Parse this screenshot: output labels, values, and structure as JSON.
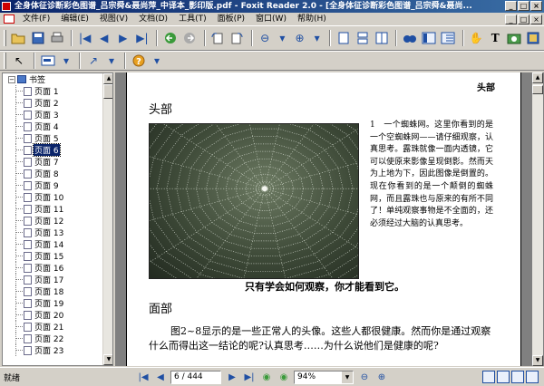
{
  "window": {
    "title": "全身体征诊断彩色图谱_吕宗舜&聂尚萍_中译本_影印版.pdf - Foxit Reader 2.0 - [全身体征诊断彩色图谱_吕宗舜&聂尚...",
    "minimize_glyph": "_",
    "maximize_glyph": "□",
    "close_glyph": "×"
  },
  "menu": {
    "items": [
      {
        "label": "文件(F)"
      },
      {
        "label": "编辑(E)"
      },
      {
        "label": "视图(V)"
      },
      {
        "label": "文档(D)"
      },
      {
        "label": "工具(T)"
      },
      {
        "label": "面板(P)"
      },
      {
        "label": "窗口(W)"
      },
      {
        "label": "帮助(H)"
      }
    ]
  },
  "toolbar": {
    "icons": [
      "open-icon",
      "save-icon",
      "print-icon",
      "first-page-icon",
      "prev-page-icon",
      "next-page-icon",
      "last-page-icon",
      "back-icon",
      "forward-icon",
      "rotate-left-icon",
      "rotate-right-icon",
      "zoom-out-icon",
      "zoom-in-icon",
      "single-page-icon",
      "continuous-icon",
      "facing-icon",
      "find-icon",
      "bookmarks-icon",
      "thumbnails-icon",
      "hand-tool-icon",
      "text-select-icon",
      "snapshot-icon",
      "properties-icon"
    ]
  },
  "sidebar": {
    "root_label": "书签",
    "items": [
      {
        "label": "页面 1"
      },
      {
        "label": "页面 2"
      },
      {
        "label": "页面 3"
      },
      {
        "label": "页面 4"
      },
      {
        "label": "页面 5"
      },
      {
        "label": "页面 6"
      },
      {
        "label": "页面 7"
      },
      {
        "label": "页面 8"
      },
      {
        "label": "页面 9"
      },
      {
        "label": "页面 10"
      },
      {
        "label": "页面 11"
      },
      {
        "label": "页面 12"
      },
      {
        "label": "页面 13"
      },
      {
        "label": "页面 14"
      },
      {
        "label": "页面 15"
      },
      {
        "label": "页面 16"
      },
      {
        "label": "页面 17"
      },
      {
        "label": "页面 18"
      },
      {
        "label": "页面 19"
      },
      {
        "label": "页面 20"
      },
      {
        "label": "页面 21"
      },
      {
        "label": "页面 22"
      },
      {
        "label": "页面 23"
      }
    ],
    "selected": "页面 6"
  },
  "document": {
    "running_head": "头部",
    "section1": "头部",
    "side_text": "1　一个蜘蛛网。这里你看到的是一个空蜘蛛网——请仔细观察，认真思考。露珠就像一面内透镜，它可以使原来影像呈现倒影。然而天为上地为下，因此图像是倒置的。现在你看到的是一个颠倒的蜘蛛网，而且露珠也与原来的有所不同了！单纯观察事物是不全面的，还必须经过大脑的认真思考。",
    "caption": "只有学会如何观察，你才能看到它。",
    "section2": "面部",
    "body": "图2~8显示的是一些正常人的头像。这些人都很健康。然而你是通过观察什么而得出这一结论的呢?认真思考……为什么说他们是健康的呢?"
  },
  "status": {
    "text": "就绪",
    "page_display": "6 / 444",
    "zoom": "94%"
  },
  "colors": {
    "titlebar_start": "#0a246a",
    "titlebar_end": "#3a6ea5",
    "chrome": "#d4d0c8",
    "selection": "#0a246a"
  }
}
